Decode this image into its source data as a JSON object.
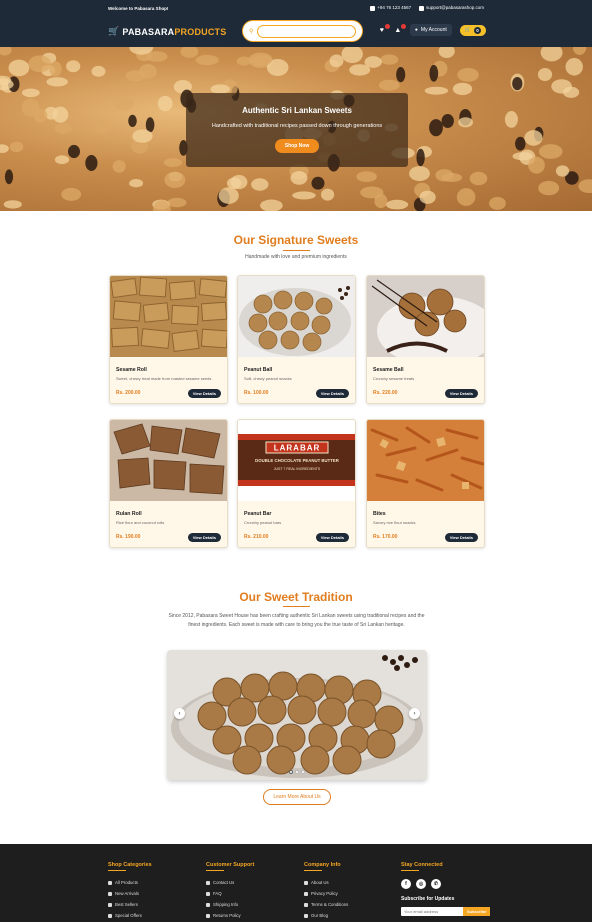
{
  "topbar": {
    "welcome": "Welcome to Pabasara Shop!",
    "phone": "+94 76 123 4567",
    "email": "support@pabasarashop.com"
  },
  "header": {
    "logo_main": "PABASARA",
    "logo_accent": "PRODUCTS",
    "search_placeholder": "",
    "account_label": "My Account",
    "cart_count": "0"
  },
  "hero": {
    "title": "Authentic Sri Lankan Sweets",
    "subtitle": "Handcrafted with traditional recipes passed down through generations",
    "button": "Shop Now"
  },
  "signature": {
    "title": "Our Signature Sweets",
    "subtitle": "Handmade with love and premium ingredients",
    "products": [
      {
        "name": "Sesame Roll",
        "desc": "Sweet, chewy treat made from roasted sesame seeds",
        "price": "Rs. 200.00",
        "button": "View Details",
        "image": "sesame-roll"
      },
      {
        "name": "Peanut Ball",
        "desc": "Soft, chewy peanut snacks",
        "price": "Rs. 100.00",
        "button": "View Details",
        "image": "peanut-ball"
      },
      {
        "name": "Sesame Ball",
        "desc": "Crunchy sesame treats",
        "price": "Rs. 220.00",
        "button": "View Details",
        "image": "sesame-ball"
      },
      {
        "name": "Rulan Roll",
        "desc": "Rice flour and coconut rolls",
        "price": "Rs. 190.00",
        "button": "View Details",
        "image": "rulan-roll"
      },
      {
        "name": "Peanut Bar",
        "desc": "Crunchy peanut bars",
        "price": "Rs. 210.00",
        "button": "View Details",
        "image": "peanut-bar"
      },
      {
        "name": "Bites",
        "desc": "Savory rice flour snacks",
        "price": "Rs. 170.00",
        "button": "View Details",
        "image": "bites"
      }
    ],
    "larabar_brand": "LARABAR",
    "larabar_line1": "DOUBLE CHOCOLATE PEANUT BUTTER",
    "larabar_line2": "JUST 7 REAL INGREDIENTS"
  },
  "tradition": {
    "title": "Our Sweet Tradition",
    "text": "Since 2012, Pabasara Sweet House has been crafting authentic Sri Lankan sweets using traditional recipes and the finest ingredients. Each sweet is made with care to bring you the true taste of Sri Lankan heritage.",
    "prev_arrow": "‹",
    "next_arrow": "›",
    "learn_more": "Learn More About Us"
  },
  "footer": {
    "shop": {
      "title": "Shop Categories",
      "items": [
        "All Products",
        "New Arrivals",
        "Best Sellers",
        "Special Offers"
      ]
    },
    "service": {
      "title": "Customer Support",
      "items": [
        "Contact Us",
        "FAQ",
        "Shipping Info",
        "Returns Policy"
      ]
    },
    "company": {
      "title": "Company Info",
      "items": [
        "About Us",
        "Privacy Policy",
        "Terms & Conditions",
        "Our Blog"
      ]
    },
    "connect": {
      "title": "Stay Connected",
      "social": [
        "f",
        "◎",
        "✆"
      ],
      "subscribe_title": "Subscribe for Updates",
      "email_placeholder": "Your email address",
      "subscribe_button": "Subscribe"
    }
  },
  "colors": {
    "navy": "#1e2a38",
    "accent": "#e07d1f",
    "gold": "#f5a623"
  }
}
